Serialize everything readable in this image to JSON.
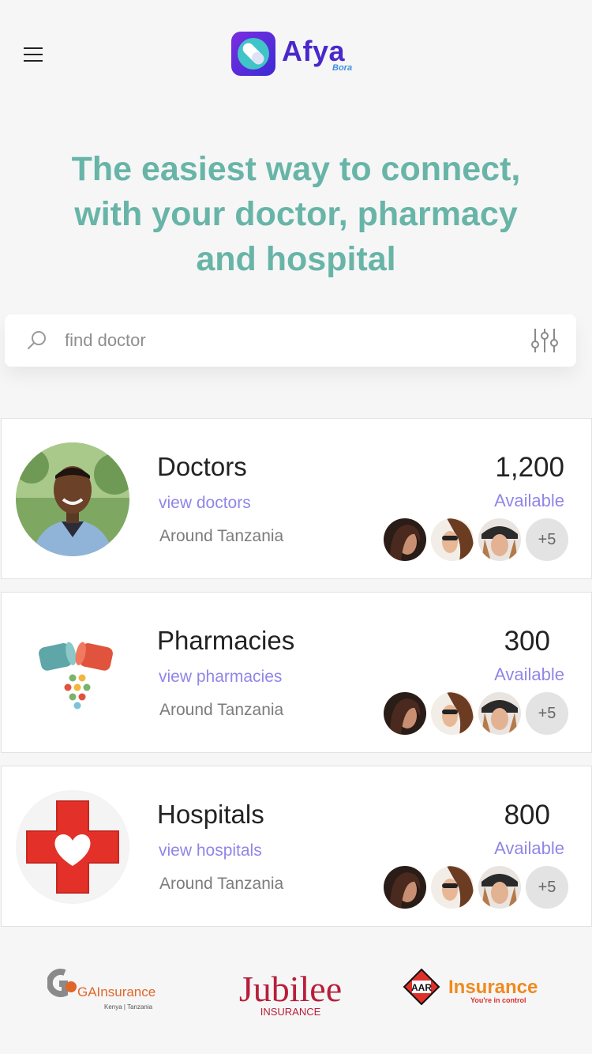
{
  "header": {
    "logo_name": "Afya",
    "logo_sub": "Bora"
  },
  "hero": {
    "line1": "The easiest way to connect,",
    "line2": "with your doctor, pharmacy",
    "line3": "and hospital"
  },
  "search": {
    "placeholder": "find doctor"
  },
  "cards": [
    {
      "title": "Doctors",
      "link": "view doctors",
      "location": "Around Tanzania",
      "count": "1,200",
      "available": "Available",
      "more": "+5"
    },
    {
      "title": "Pharmacies",
      "link": "view pharmacies",
      "location": "Around Tanzania",
      "count": "300",
      "available": "Available",
      "more": "+5"
    },
    {
      "title": "Hospitals",
      "link": "view hospitals",
      "location": "Around Tanzania",
      "count": "800",
      "available": "Available",
      "more": "+5"
    }
  ],
  "partners": {
    "ga": {
      "name": "GAInsurance",
      "sub": "Kenya | Tanzania"
    },
    "jubilee": {
      "name": "Jubilee",
      "sub": "INSURANCE"
    },
    "aar": {
      "mark": "AAR",
      "name": "Insurance",
      "sub": "You're in control"
    }
  },
  "colors": {
    "accent_teal": "#68b5a8",
    "link_purple": "#8f86e8",
    "logo_purple": "#4a28c9",
    "background": "#f6f6f6"
  },
  "icons": [
    "menu-icon",
    "search-icon",
    "filter-icon",
    "pill-icon",
    "hospital-cross-icon"
  ]
}
